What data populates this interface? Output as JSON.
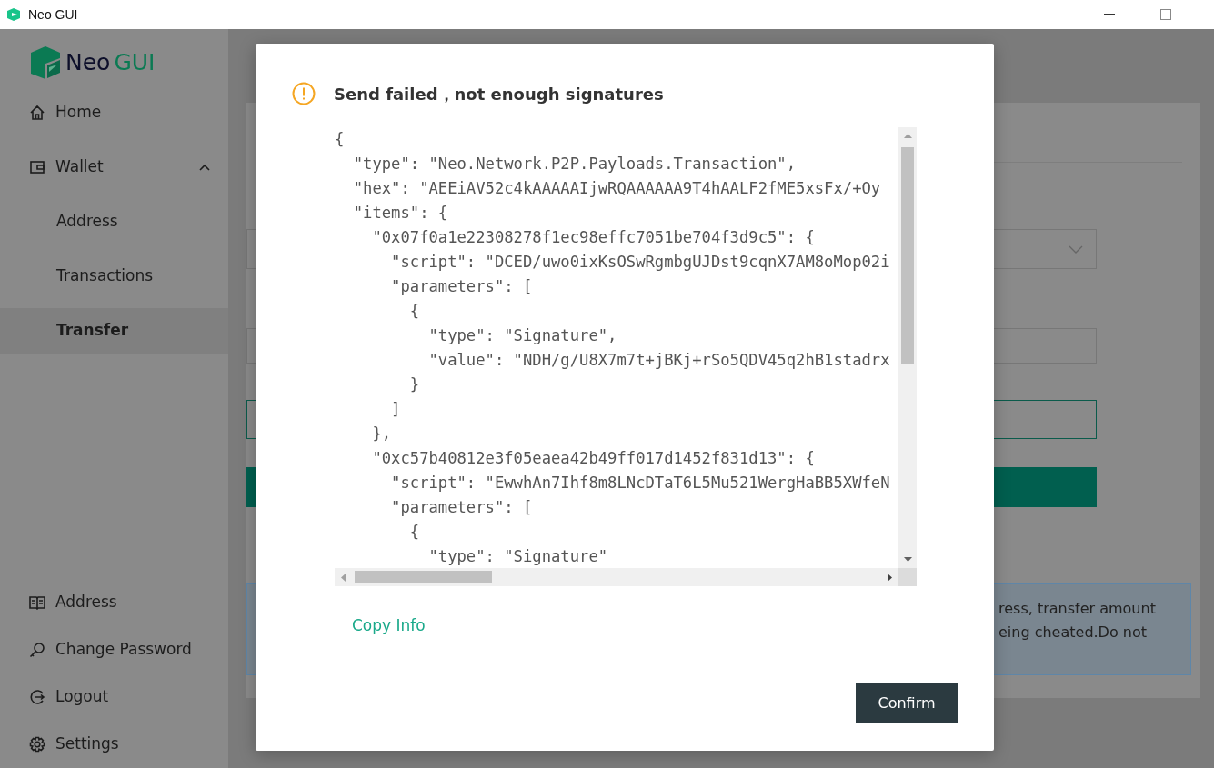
{
  "window": {
    "title": "Neo GUI"
  },
  "logo": {
    "name": "Neo",
    "suffix": "GUI"
  },
  "nav": [
    {
      "label": "Home",
      "selected": false
    },
    {
      "label": "Wallet",
      "selected": false,
      "expanded": true,
      "children": [
        {
          "label": "Address",
          "selected": false
        },
        {
          "label": "Transactions",
          "selected": false
        },
        {
          "label": "Transfer",
          "selected": true
        }
      ]
    }
  ],
  "bottom_nav": [
    {
      "label": "Address"
    },
    {
      "label": "Change Password"
    },
    {
      "label": "Logout"
    },
    {
      "label": "Settings"
    }
  ],
  "background_alert": {
    "lines": [
      "ress, transfer amount",
      "eing cheated.Do not"
    ]
  },
  "dialog": {
    "title": "Send failed，not enough signatures",
    "code_lines": [
      "{",
      "  \"type\": \"Neo.Network.P2P.Payloads.Transaction\",",
      "  \"hex\": \"AEEiAV52c4kAAAAAIjwRQAAAAAA9T4hAALF2fME5xsFx/+Oy",
      "  \"items\": {",
      "    \"0x07f0a1e22308278f1ec98effc7051be704f3d9c5\": {",
      "      \"script\": \"DCED/uwo0ixKsOSwRgmbgUJDst9cqnX7AM8oMop02i",
      "      \"parameters\": [",
      "        {",
      "          \"type\": \"Signature\",",
      "          \"value\": \"NDH/g/U8X7m7t+jBKj+rSo5QDV45q2hB1stadrx",
      "        }",
      "      ]",
      "    },",
      "    \"0xc57b40812e3f05eaea42b49ff017d1452f831d13\": {",
      "      \"script\": \"EwwhAn7Ihf8m8LNcDTaT6L5Mu521WergHaBB5XWfeN",
      "      \"parameters\": [",
      "        {",
      "          \"type\": \"Signature\""
    ],
    "copy_link": "Copy Info",
    "confirm_button": "Confirm"
  }
}
